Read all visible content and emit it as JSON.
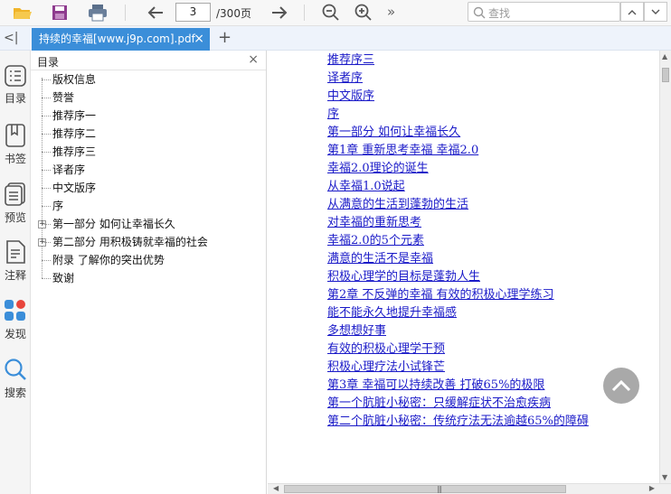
{
  "toolbar": {
    "page_current": "3",
    "page_total": "/300页",
    "more": "»",
    "search_placeholder": "查找"
  },
  "tab": {
    "title": "持续的幸福[www.j9p.com].pdf",
    "close": "×",
    "add": "+",
    "collapse": "<|"
  },
  "rail": [
    {
      "label": "目录",
      "icon": "toc-icon"
    },
    {
      "label": "书签",
      "icon": "bookmark-icon"
    },
    {
      "label": "预览",
      "icon": "preview-icon"
    },
    {
      "label": "注释",
      "icon": "annotation-icon"
    },
    {
      "label": "发现",
      "icon": "discover-icon"
    },
    {
      "label": "搜索",
      "icon": "search-icon"
    }
  ],
  "outline": {
    "title": "目录",
    "close": "×",
    "items": [
      {
        "label": "版权信息",
        "expandable": false
      },
      {
        "label": "赞誉",
        "expandable": false
      },
      {
        "label": "推荐序一",
        "expandable": false
      },
      {
        "label": "推荐序二",
        "expandable": false
      },
      {
        "label": "推荐序三",
        "expandable": false
      },
      {
        "label": "译者序",
        "expandable": false
      },
      {
        "label": "中文版序",
        "expandable": false
      },
      {
        "label": "序",
        "expandable": false
      },
      {
        "label": "第一部分 如何让幸福长久",
        "expandable": true
      },
      {
        "label": "第二部分 用积极铸就幸福的社会",
        "expandable": true
      },
      {
        "label": "附录 了解你的突出优势",
        "expandable": false
      },
      {
        "label": "致谢",
        "expandable": false
      }
    ]
  },
  "content": {
    "links": [
      "推荐序三",
      "译者序",
      "中文版序",
      "序",
      "第一部分 如何让幸福长久",
      "第1章 重新思考幸福 幸福2.0",
      "幸福2.0理论的诞生",
      "从幸福1.0说起",
      "从满意的生活到蓬勃的生活",
      "对幸福的重新思考",
      "幸福2.0的5个元素",
      "满意的生活不是幸福",
      "积极心理学的目标是蓬勃人生",
      "第2章 不反弹的幸福 有效的积极心理学练习",
      "能不能永久地提升幸福感",
      "多想想好事",
      "有效的积极心理学干预",
      "积极心理疗法小试锋芒",
      "第3章 幸福可以持续改善 打破65%的极限",
      "第一个肮脏小秘密：只缓解症状不治愈疾病",
      "第二个肮脏小秘密：传统疗法无法逾越65%的障碍"
    ]
  },
  "colors": {
    "accent": "#3b8ed9",
    "link": "#1a1ac8"
  }
}
